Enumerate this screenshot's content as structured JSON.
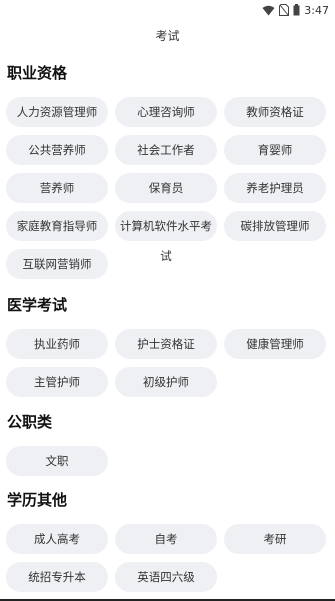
{
  "status_bar": {
    "time": "3:47"
  },
  "header": {
    "title": "考试"
  },
  "sections": [
    {
      "title": "职业资格",
      "items": [
        "人力资源管理师",
        "心理咨询师",
        "教师资格证",
        "公共营养师",
        "社会工作者",
        "育婴师",
        "营养师",
        "保育员",
        "养老护理员",
        "家庭教育指导师",
        "计算机软件水平考试",
        "碳排放管理师",
        "互联网营销师"
      ]
    },
    {
      "title": "医学考试",
      "items": [
        "执业药师",
        "护士资格证",
        "健康管理师",
        "主管护师",
        "初级护师"
      ]
    },
    {
      "title": "公职类",
      "items": [
        "文职"
      ]
    },
    {
      "title": "学历其他",
      "items": [
        "成人高考",
        "自考",
        "考研",
        "统招专升本",
        "英语四六级"
      ]
    }
  ],
  "colors": {
    "chip_bg": "#eef0f4",
    "text": "#333333"
  }
}
